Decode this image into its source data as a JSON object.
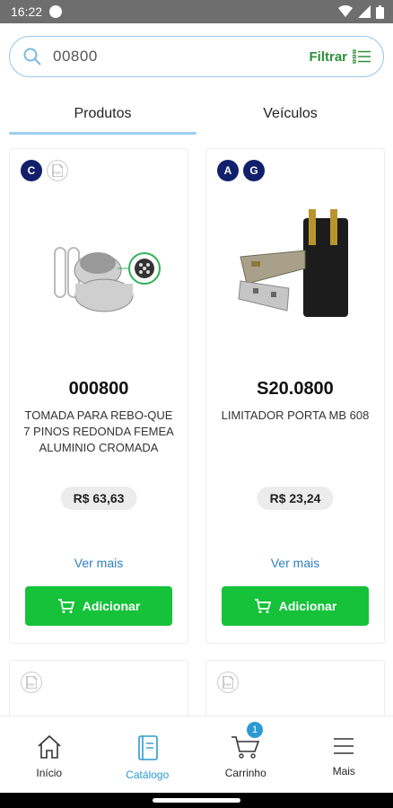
{
  "status": {
    "time": "16:22"
  },
  "search": {
    "query": "00800",
    "filter_label": "Filtrar"
  },
  "tabs": [
    {
      "label": "Produtos"
    },
    {
      "label": "Veículos"
    }
  ],
  "products": [
    {
      "badges": [
        "C"
      ],
      "code": "000800",
      "description": "TOMADA PARA REBO-QUE 7 PINOS REDONDA FEMEA ALUMINIO CROMADA",
      "price": "R$ 63,63",
      "more_label": "Ver mais",
      "add_label": "Adicionar"
    },
    {
      "badges": [
        "A",
        "G"
      ],
      "code": "S20.0800",
      "description": "LIMITADOR PORTA MB 608",
      "price": "R$ 23,24",
      "more_label": "Ver mais",
      "add_label": "Adicionar"
    }
  ],
  "nav": [
    {
      "label": "Início",
      "icon": "home-icon"
    },
    {
      "label": "Catálogo",
      "icon": "catalog-icon"
    },
    {
      "label": "Carrinho",
      "icon": "cart-icon",
      "badge": "1"
    },
    {
      "label": "Mais",
      "icon": "menu-icon"
    }
  ],
  "colors": {
    "accent_green": "#15c23a",
    "accent_blue": "#2b9ad3",
    "badge_navy": "#12206b",
    "filter_green": "#2f8f3a"
  }
}
